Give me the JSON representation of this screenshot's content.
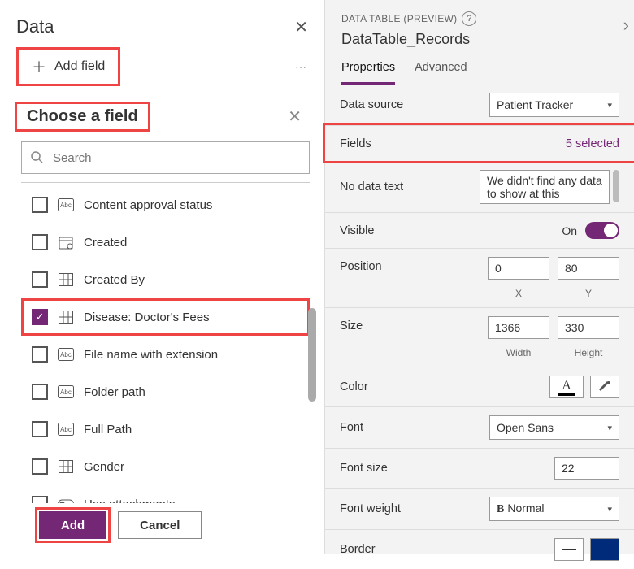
{
  "left": {
    "title": "Data",
    "addField": "Add field",
    "chooseTitle": "Choose a field",
    "searchPlaceholder": "Search",
    "fields": [
      {
        "label": "Content approval status",
        "icon": "abc",
        "checked": false
      },
      {
        "label": "Created",
        "icon": "calendar",
        "checked": false
      },
      {
        "label": "Created By",
        "icon": "grid",
        "checked": false
      },
      {
        "label": "Disease: Doctor's Fees",
        "icon": "grid",
        "checked": true,
        "hl": true
      },
      {
        "label": "File name with extension",
        "icon": "abc",
        "checked": false
      },
      {
        "label": "Folder path",
        "icon": "abc",
        "checked": false
      },
      {
        "label": "Full Path",
        "icon": "abc",
        "checked": false
      },
      {
        "label": "Gender",
        "icon": "grid",
        "checked": false
      },
      {
        "label": "Has attachments",
        "icon": "toggle",
        "checked": false
      }
    ],
    "addBtn": "Add",
    "cancelBtn": "Cancel"
  },
  "right": {
    "headerSmall": "DATA TABLE (PREVIEW)",
    "recordName": "DataTable_Records",
    "tabs": {
      "properties": "Properties",
      "advanced": "Advanced"
    },
    "props": {
      "dataSource": {
        "label": "Data source",
        "value": "Patient Tracker"
      },
      "fields": {
        "label": "Fields",
        "value": "5 selected"
      },
      "noData": {
        "label": "No data text",
        "value": "We didn't find any data to show at this"
      },
      "visible": {
        "label": "Visible",
        "value": "On"
      },
      "position": {
        "label": "Position",
        "x": "0",
        "y": "80",
        "xl": "X",
        "yl": "Y"
      },
      "size": {
        "label": "Size",
        "w": "1366",
        "h": "330",
        "wl": "Width",
        "hl": "Height"
      },
      "color": {
        "label": "Color"
      },
      "font": {
        "label": "Font",
        "value": "Open Sans"
      },
      "fontSize": {
        "label": "Font size",
        "value": "22"
      },
      "fontWeight": {
        "label": "Font weight",
        "value": "Normal"
      },
      "border": {
        "label": "Border"
      }
    }
  }
}
